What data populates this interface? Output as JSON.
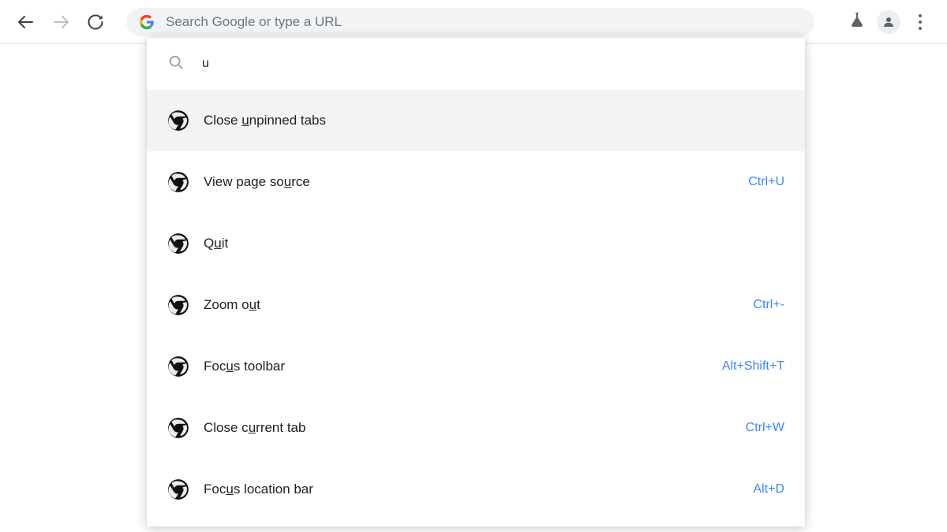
{
  "toolbar": {
    "back_icon": "arrow-left-icon",
    "forward_icon": "arrow-right-icon",
    "reload_icon": "reload-icon",
    "omnibox": {
      "placeholder": "Search Google or type a URL",
      "value": "",
      "leading_icon": "google-g-icon"
    },
    "experiments_icon": "flask-icon",
    "profile_icon": "profile-avatar-icon",
    "menu_icon": "three-dot-menu-icon"
  },
  "palette": {
    "search_icon": "search-icon",
    "query": "u",
    "rows": [
      {
        "icon": "chrome-icon",
        "label_before": "Close ",
        "label_match": "u",
        "label_after": "npinned tabs",
        "full_label": "Close unpinned tabs",
        "shortcut": "",
        "selected": true
      },
      {
        "icon": "chrome-icon",
        "label_before": "View page so",
        "label_match": "u",
        "label_after": "rce",
        "full_label": "View page source",
        "shortcut": "Ctrl+U",
        "selected": false
      },
      {
        "icon": "chrome-icon",
        "label_before": "Q",
        "label_match": "u",
        "label_after": "it",
        "full_label": "Quit",
        "shortcut": "",
        "selected": false
      },
      {
        "icon": "chrome-icon",
        "label_before": "Zoom o",
        "label_match": "u",
        "label_after": "t",
        "full_label": "Zoom out",
        "shortcut": "Ctrl+-",
        "selected": false
      },
      {
        "icon": "chrome-icon",
        "label_before": "Foc",
        "label_match": "u",
        "label_after": "s toolbar",
        "full_label": "Focus toolbar",
        "shortcut": "Alt+Shift+T",
        "selected": false
      },
      {
        "icon": "chrome-icon",
        "label_before": "Close c",
        "label_match": "u",
        "label_after": "rrent tab",
        "full_label": "Close current tab",
        "shortcut": "Ctrl+W",
        "selected": false
      },
      {
        "icon": "chrome-icon",
        "label_before": "Foc",
        "label_match": "u",
        "label_after": "s location bar",
        "full_label": "Focus location bar",
        "shortcut": "Alt+D",
        "selected": false
      }
    ]
  },
  "colors": {
    "shortcut_blue": "#4285f4",
    "selected_row_bg": "#f1f3f4",
    "omnibox_bg": "#f1f3f4",
    "text_primary": "#202124",
    "text_placeholder": "#70757a"
  }
}
